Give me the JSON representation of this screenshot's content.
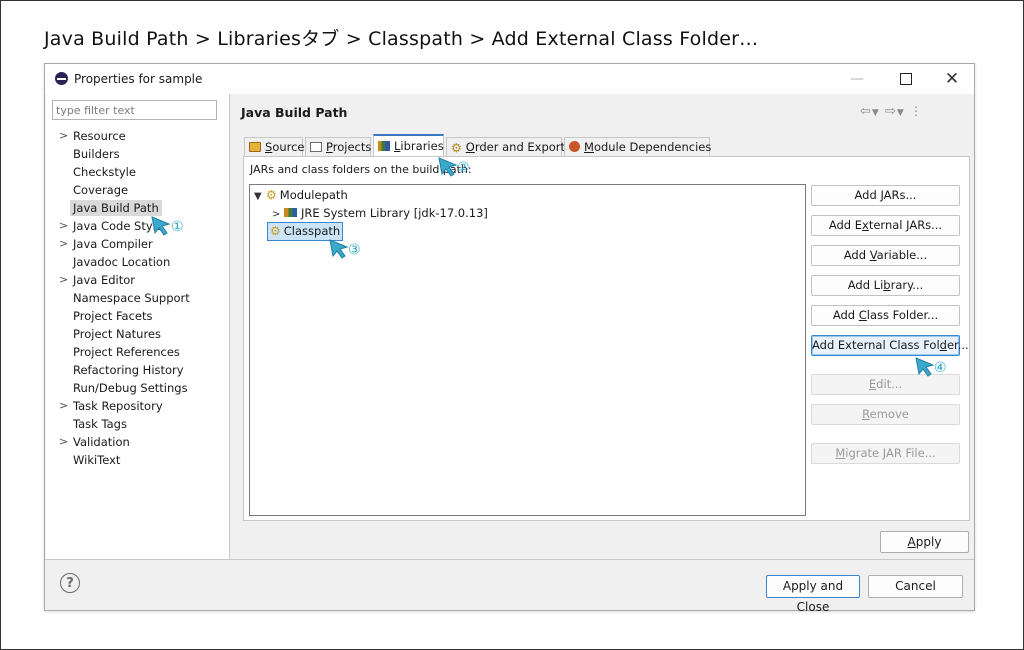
{
  "caption": "Java Build Path > Librariesタブ > Classpath > Add External Class Folder…",
  "window": {
    "title": "Properties for sample",
    "controls": {
      "minimize": "—",
      "close": "✕"
    }
  },
  "left": {
    "filter_placeholder": "type filter text",
    "items": [
      {
        "label": "Resource",
        "expandable": true
      },
      {
        "label": "Builders",
        "expandable": false
      },
      {
        "label": "Checkstyle",
        "expandable": false
      },
      {
        "label": "Coverage",
        "expandable": false
      },
      {
        "label": "Java Build Path",
        "expandable": false,
        "selected": true
      },
      {
        "label": "Java Code Style",
        "expandable": true
      },
      {
        "label": "Java Compiler",
        "expandable": true
      },
      {
        "label": "Javadoc Location",
        "expandable": false
      },
      {
        "label": "Java Editor",
        "expandable": true
      },
      {
        "label": "Namespace Support",
        "expandable": false
      },
      {
        "label": "Project Facets",
        "expandable": false
      },
      {
        "label": "Project Natures",
        "expandable": false
      },
      {
        "label": "Project References",
        "expandable": false
      },
      {
        "label": "Refactoring History",
        "expandable": false
      },
      {
        "label": "Run/Debug Settings",
        "expandable": false
      },
      {
        "label": "Task Repository",
        "expandable": true
      },
      {
        "label": "Task Tags",
        "expandable": false
      },
      {
        "label": "Validation",
        "expandable": true
      },
      {
        "label": "WikiText",
        "expandable": false
      }
    ]
  },
  "right": {
    "title": "Java Build Path",
    "tabs": {
      "source": {
        "mnemonic": "S",
        "rest": "ource"
      },
      "projects": {
        "mnemonic": "P",
        "rest": "rojects"
      },
      "libraries": {
        "mnemonic": "L",
        "rest": "ibraries",
        "active": true
      },
      "order": {
        "mnemonic": "O",
        "rest": "rder and Export"
      },
      "module": {
        "mnemonic": "M",
        "rest": "odule Dependencies"
      }
    },
    "description": "JARs and class folders on the build path:",
    "tree": {
      "modulepath": "Modulepath",
      "jre": "JRE System Library [jdk-17.0.13]",
      "classpath": "Classpath"
    },
    "buttons": {
      "add_jars": {
        "pre": "Add ",
        "mn": "J",
        "post": "ARs..."
      },
      "add_external_jars": {
        "pre": "Add E",
        "mn": "x",
        "post": "ternal JARs..."
      },
      "add_variable": {
        "pre": "Add ",
        "mn": "V",
        "post": "ariable..."
      },
      "add_library": {
        "pre": "Add Li",
        "mn": "b",
        "post": "rary..."
      },
      "add_class_folder": {
        "pre": "Add ",
        "mn": "C",
        "post": "lass Folder..."
      },
      "add_external_class_folder": {
        "pre": "Add External Class Fol",
        "mn": "d",
        "post": "er..."
      },
      "edit": {
        "pre": "",
        "mn": "E",
        "post": "dit..."
      },
      "remove": {
        "pre": "",
        "mn": "R",
        "post": "emove"
      },
      "migrate": {
        "pre": "",
        "mn": "M",
        "post": "igrate JAR File..."
      }
    },
    "apply": {
      "mn": "A",
      "post": "pply"
    }
  },
  "footer": {
    "help": "?",
    "apply_and_close": "Apply and Close",
    "cancel": "Cancel"
  },
  "markers": [
    "①",
    "②",
    "③",
    "④"
  ],
  "colors": {
    "pointer": "#3aa9cc",
    "accent": "#3a86d0",
    "selection": "#cce4f7"
  }
}
